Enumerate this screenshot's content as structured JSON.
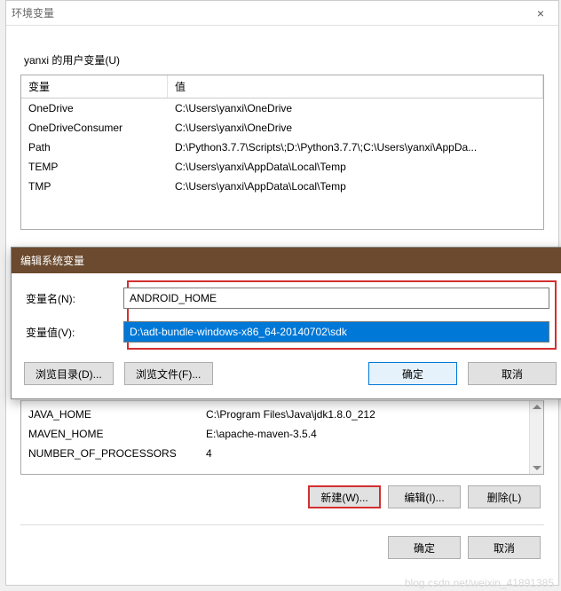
{
  "main_dialog": {
    "title": "环境变量",
    "close_symbol": "×",
    "user_section_label": "yanxi 的用户变量(U)",
    "col_var": "变量",
    "col_val": "值",
    "user_vars": [
      {
        "name": "OneDrive",
        "value": "C:\\Users\\yanxi\\OneDrive"
      },
      {
        "name": "OneDriveConsumer",
        "value": "C:\\Users\\yanxi\\OneDrive"
      },
      {
        "name": "Path",
        "value": "D:\\Python3.7.7\\Scripts\\;D:\\Python3.7.7\\;C:\\Users\\yanxi\\AppDa..."
      },
      {
        "name": "TEMP",
        "value": "C:\\Users\\yanxi\\AppData\\Local\\Temp"
      },
      {
        "name": "TMP",
        "value": "C:\\Users\\yanxi\\AppData\\Local\\Temp"
      }
    ],
    "sys_vars": [
      {
        "name": "JAVA_HOME",
        "value": "C:\\Program Files\\Java\\jdk1.8.0_212"
      },
      {
        "name": "MAVEN_HOME",
        "value": "E:\\apache-maven-3.5.4"
      },
      {
        "name": "NUMBER_OF_PROCESSORS",
        "value": "4"
      }
    ],
    "buttons": {
      "new_sys": "新建(W)...",
      "edit_sys": "编辑(I)...",
      "delete_sys": "删除(L)",
      "ok": "确定",
      "cancel": "取消"
    }
  },
  "edit_dialog": {
    "title": "编辑系统变量",
    "name_label": "变量名(N):",
    "value_label": "变量值(V):",
    "name_value": "ANDROID_HOME",
    "value_value": "D:\\adt-bundle-windows-x86_64-20140702\\sdk",
    "browse_dir": "浏览目录(D)...",
    "browse_file": "浏览文件(F)...",
    "ok": "确定",
    "cancel": "取消"
  },
  "watermark": "blog.csdn.net/weixin_41891385"
}
